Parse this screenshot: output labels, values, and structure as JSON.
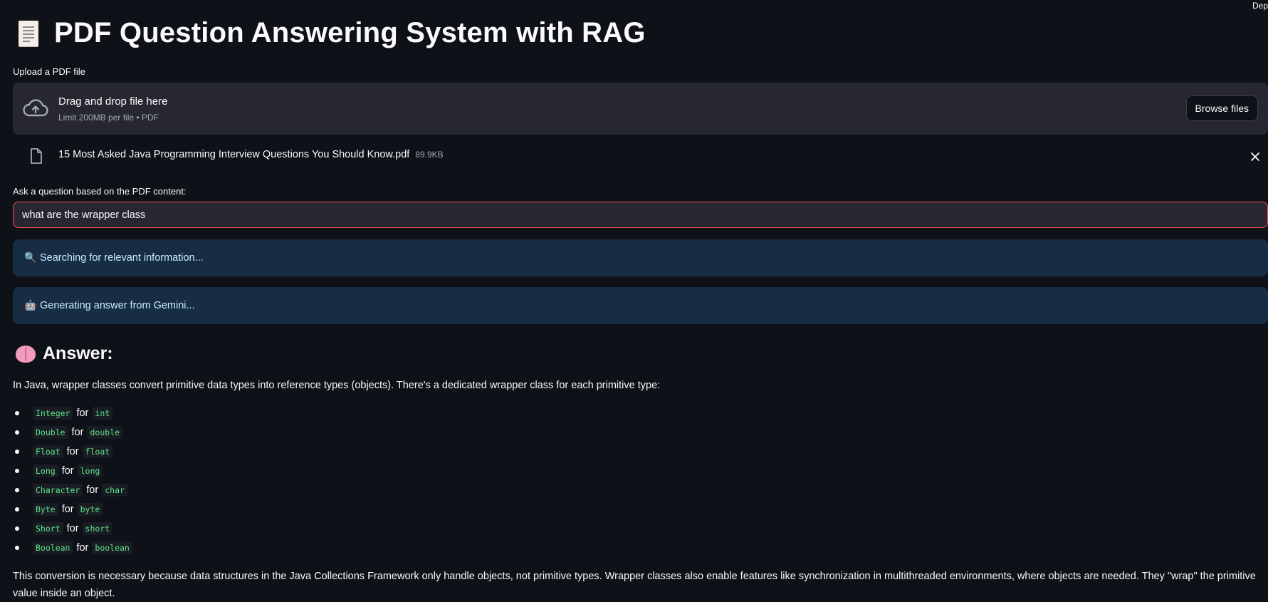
{
  "header": {
    "deploy_label": "Dep",
    "title": "PDF Question Answering System with RAG",
    "title_icon": "page-facing-up-icon"
  },
  "uploader": {
    "label": "Upload a PDF file",
    "drop_text": "Drag and drop file here",
    "limit_text": "Limit 200MB per file • PDF",
    "browse_label": "Browse files",
    "uploaded_file": {
      "name": "15 Most Asked Java Programming Interview Questions You Should Know.pdf",
      "size": "89.9KB"
    }
  },
  "question": {
    "label": "Ask a question based on the PDF content:",
    "value": "what are the wrapper class"
  },
  "status": {
    "searching": "Searching for relevant information...",
    "searching_icon": "magnifying-glass-icon",
    "generating": "Generating answer from Gemini...",
    "generating_icon": "robot-icon"
  },
  "answer": {
    "heading": "Answer:",
    "heading_icon": "brain-icon",
    "intro": "In Java, wrapper classes convert primitive data types into reference types (objects). There's a dedicated wrapper class for each primitive type:",
    "connector": "for",
    "items": [
      {
        "wrapper": "Integer",
        "primitive": "int"
      },
      {
        "wrapper": "Double",
        "primitive": "double"
      },
      {
        "wrapper": "Float",
        "primitive": "float"
      },
      {
        "wrapper": "Long",
        "primitive": "long"
      },
      {
        "wrapper": "Character",
        "primitive": "char"
      },
      {
        "wrapper": "Byte",
        "primitive": "byte"
      },
      {
        "wrapper": "Short",
        "primitive": "short"
      },
      {
        "wrapper": "Boolean",
        "primitive": "boolean"
      }
    ],
    "conclusion": "This conversion is necessary because data structures in the Java Collections Framework only handle objects, not primitive types. Wrapper classes also enable features like synchronization in multithreaded environments, where objects are needed. They \"wrap\" the primitive value inside an object."
  },
  "colors": {
    "background": "#0e1117",
    "panel": "#262730",
    "accent": "#ff4b4b",
    "info_bg": "#172d43",
    "info_text": "#c7ebff",
    "code_text": "#5ce488"
  }
}
